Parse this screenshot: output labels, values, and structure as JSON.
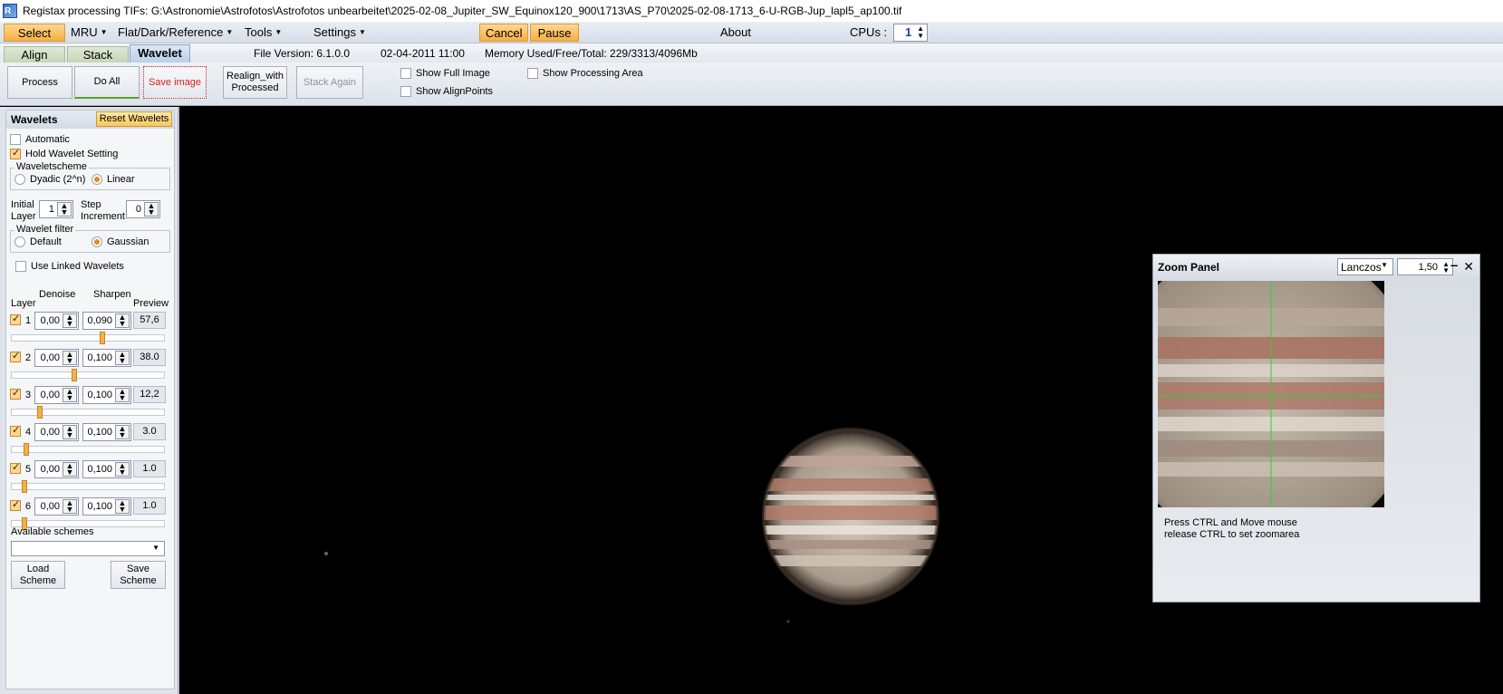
{
  "window": {
    "title": "Registax processing TIFs: G:\\Astronomie\\Astrofotos\\Astrofotos unbearbeitet\\2025-02-08_Jupiter_SW_Equinox120_900\\1713\\AS_P70\\2025-02-08-1713_6-U-RGB-Jup_lapl5_ap100.tif",
    "icon_label": "R"
  },
  "menu": {
    "select": "Select",
    "mru": "MRU",
    "flat": "Flat/Dark/Reference",
    "tools": "Tools",
    "settings": "Settings",
    "cancel": "Cancel",
    "pause": "Pause",
    "about": "About",
    "cpus_label": "CPUs :",
    "cpus_value": "1"
  },
  "tabs": {
    "align": "Align",
    "stack": "Stack",
    "wavelet": "Wavelet",
    "file_version": "File Version: 6.1.0.0",
    "date": "02-04-2011 11:00",
    "memory": "Memory Used/Free/Total: 229/3313/4096Mb"
  },
  "toolbar": {
    "process": "Process",
    "do_all": "Do All",
    "save_image": "Save image",
    "realign_1": "Realign_with",
    "realign_2": "Processed",
    "stack_again": "Stack Again",
    "show_full_image": "Show Full Image",
    "show_alignpoints": "Show AlignPoints",
    "show_processing_area": "Show Processing Area"
  },
  "wavelets": {
    "title": "Wavelets",
    "reset": "Reset Wavelets",
    "automatic": "Automatic",
    "hold_setting": "Hold Wavelet Setting",
    "scheme_title": "Waveletscheme",
    "dyadic": "Dyadic (2^n)",
    "linear": "Linear",
    "initial_layer_1": "Initial",
    "initial_layer_2": "Layer",
    "initial_layer_value": "1",
    "step_1": "Step",
    "step_2": "Increment",
    "step_value": "0",
    "filter_title": "Wavelet filter",
    "filter_default": "Default",
    "filter_gaussian": "Gaussian",
    "use_linked": "Use Linked Wavelets",
    "col_denoise": "Denoise",
    "col_sharpen": "Sharpen",
    "col_layer": "Layer",
    "col_preview": "Preview",
    "layers": [
      {
        "num": "1",
        "denoise": "0,00",
        "sharpen": "0,090",
        "preview": "57,6",
        "slider": 0.59
      },
      {
        "num": "2",
        "denoise": "0,00",
        "sharpen": "0,100",
        "preview": "38.0",
        "slider": 0.4
      },
      {
        "num": "3",
        "denoise": "0,00",
        "sharpen": "0,100",
        "preview": "12,2",
        "slider": 0.17
      },
      {
        "num": "4",
        "denoise": "0,00",
        "sharpen": "0,100",
        "preview": "3.0",
        "slider": 0.08
      },
      {
        "num": "5",
        "denoise": "0,00",
        "sharpen": "0,100",
        "preview": "1.0",
        "slider": 0.07
      },
      {
        "num": "6",
        "denoise": "0,00",
        "sharpen": "0,100",
        "preview": "1.0",
        "slider": 0.07
      }
    ],
    "available_schemes": "Available schemes",
    "load_1": "Load",
    "load_2": "Scheme",
    "save_1": "Save",
    "save_2": "Scheme"
  },
  "zoom": {
    "title": "Zoom Panel",
    "method": "Lanczos",
    "factor": "1,50",
    "hint_1": "Press CTRL and Move mouse",
    "hint_2": "release CTRL to set zoomarea"
  },
  "colors": {
    "orange_button": "#f7ae43",
    "accent_blue": "#b9cfea",
    "background": "#000000",
    "crosshair": "#2bd62b"
  }
}
